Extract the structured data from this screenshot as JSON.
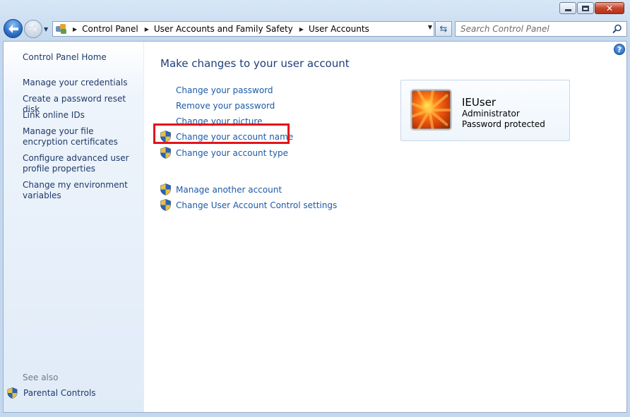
{
  "window": {
    "caption": {
      "minimize_glyph": "minimize-icon",
      "maximize_glyph": "maximize-icon",
      "close_glyph": "✕"
    }
  },
  "address_bar": {
    "breadcrumbs": [
      "Control Panel",
      "User Accounts and Family Safety",
      "User Accounts"
    ],
    "icon": "control-panel-icon"
  },
  "search": {
    "placeholder": "Search Control Panel",
    "value": ""
  },
  "sidebar": {
    "home": "Control Panel Home",
    "links": [
      "Manage your credentials",
      "Create a password reset disk",
      "Link online IDs",
      "Manage your file encryption certificates",
      "Configure advanced user profile properties",
      "Change my environment variables"
    ],
    "see_also": "See also",
    "parental_controls": "Parental Controls"
  },
  "main": {
    "title": "Make changes to your user account",
    "tasks": [
      {
        "label": "Change your password",
        "shield": false
      },
      {
        "label": "Remove your password",
        "shield": false
      },
      {
        "label": "Change your picture",
        "shield": false
      },
      {
        "label": "Change your account name",
        "shield": true,
        "highlighted": true
      },
      {
        "label": "Change your account type",
        "shield": true
      }
    ],
    "other_tasks": [
      {
        "label": "Manage another account",
        "shield": true
      },
      {
        "label": "Change User Account Control settings",
        "shield": true
      }
    ]
  },
  "user_card": {
    "name": "IEUser",
    "role": "Administrator",
    "status": "Password protected"
  },
  "colors": {
    "highlight": "#e2141c",
    "link": "#1c5aa6",
    "title": "#1e3f78"
  },
  "help": {
    "glyph": "?"
  }
}
